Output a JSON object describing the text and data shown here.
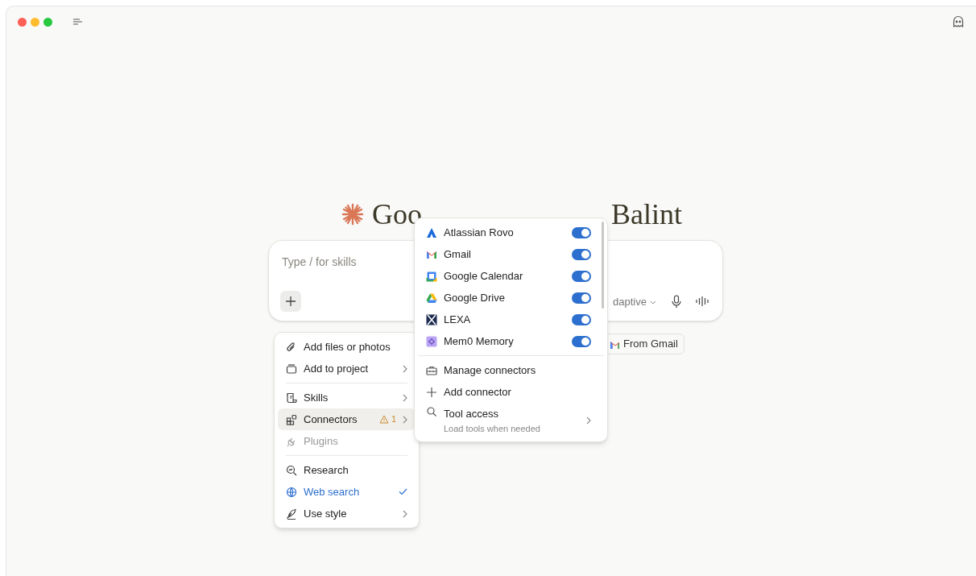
{
  "greeting": [
    "Goo",
    "Balint"
  ],
  "composer": {
    "placeholder": "Type / for skills",
    "model": "daptive"
  },
  "suggestion_chips": [
    {
      "label": "From Gmail"
    }
  ],
  "add_menu": {
    "groups": [
      [
        {
          "label": "Add files or photos",
          "submenu": false,
          "selected": false,
          "checked": false,
          "disabled": false
        },
        {
          "label": "Add to project",
          "submenu": true,
          "selected": false,
          "checked": false,
          "disabled": false
        }
      ],
      [
        {
          "label": "Skills",
          "submenu": true,
          "selected": false,
          "checked": false,
          "disabled": false
        },
        {
          "label": "Connectors",
          "submenu": true,
          "selected": true,
          "checked": false,
          "disabled": false,
          "warning": "1"
        },
        {
          "label": "Plugins",
          "submenu": false,
          "selected": false,
          "checked": false,
          "disabled": true
        }
      ],
      [
        {
          "label": "Research",
          "submenu": false,
          "selected": false,
          "checked": false,
          "disabled": false
        },
        {
          "label": "Web search",
          "submenu": false,
          "selected": false,
          "checked": true,
          "disabled": false
        },
        {
          "label": "Use style",
          "submenu": true,
          "selected": false,
          "checked": false,
          "disabled": false
        }
      ]
    ]
  },
  "connectors_menu": {
    "connectors": [
      {
        "name": "Atlassian Rovo",
        "on": true
      },
      {
        "name": "Gmail",
        "on": true
      },
      {
        "name": "Google Calendar",
        "on": true
      },
      {
        "name": "Google Drive",
        "on": true
      },
      {
        "name": "LEXA",
        "on": true
      },
      {
        "name": "Mem0 Memory",
        "on": true
      }
    ],
    "actions": [
      {
        "label": "Manage connectors",
        "submenu": false
      },
      {
        "label": "Add connector",
        "submenu": false
      },
      {
        "label": "Tool access",
        "submenu": true,
        "subtitle": "Load tools when needed"
      }
    ]
  }
}
